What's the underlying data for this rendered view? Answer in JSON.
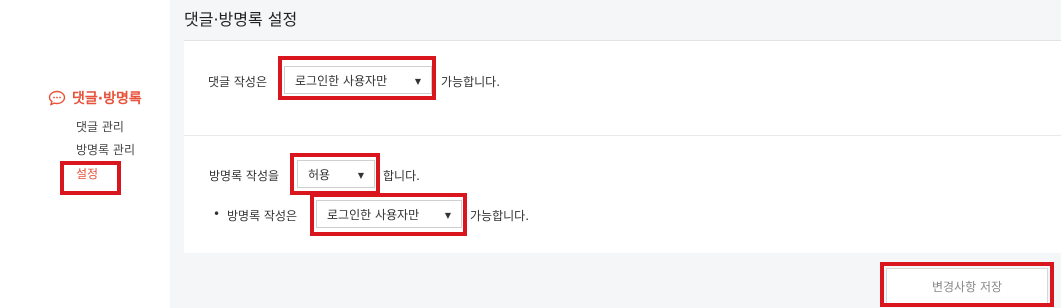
{
  "page_title": "댓글·방명록 설정",
  "sidebar": {
    "section_title": "댓글·방명록",
    "items": [
      {
        "label": "댓글 관리"
      },
      {
        "label": "방명록 관리"
      },
      {
        "label": "설정"
      }
    ]
  },
  "comments": {
    "prefix": "댓글 작성은",
    "selected": "로그인한 사용자만",
    "suffix": "가능합니다."
  },
  "guestbook": {
    "prefix": "방명록 작성을",
    "selected": "허용",
    "suffix": "합니다.",
    "sub_bullet": "•",
    "sub_prefix": "방명록 작성은",
    "sub_selected": "로그인한 사용자만",
    "sub_suffix": "가능합니다."
  },
  "actions": {
    "save_label": "변경사항 저장"
  },
  "colors": {
    "accent": "#e8523a",
    "highlight": "#d9161d",
    "background": "#f5f6f7"
  }
}
